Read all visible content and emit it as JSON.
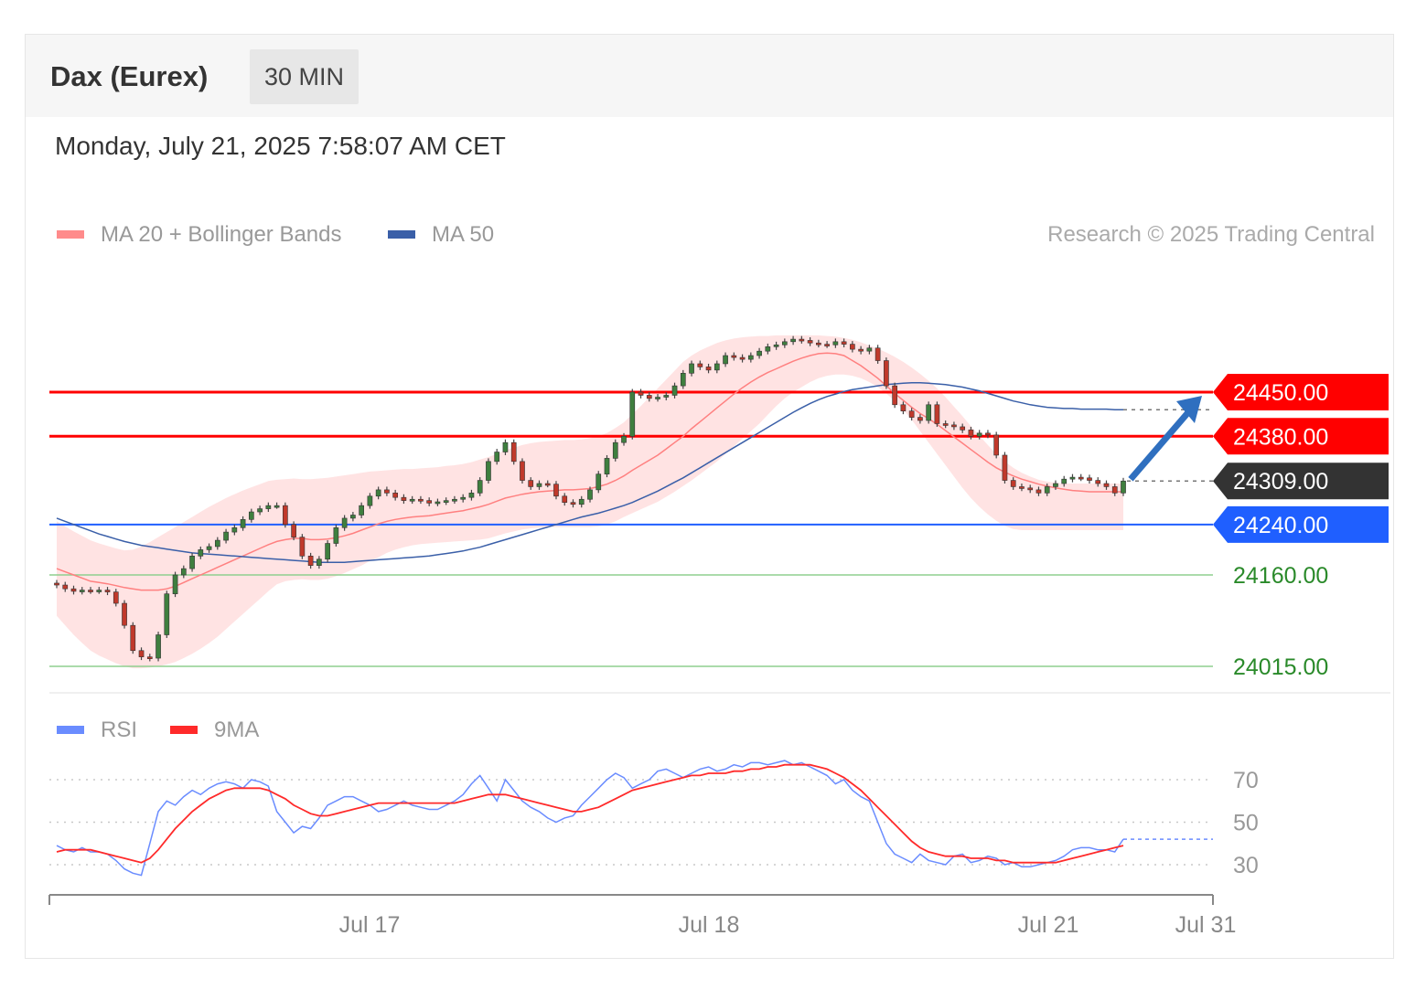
{
  "header": {
    "title": "Dax (Eurex)",
    "interval": "30 MIN",
    "datetime": "Monday, July 21, 2025 7:58:07 AM CET"
  },
  "legend": {
    "ma20": "MA 20 + Bollinger Bands",
    "ma50": "MA 50",
    "rsi": "RSI",
    "ma9": "9MA",
    "copyright": "Research © 2025 Trading Central"
  },
  "colors": {
    "resistance": "#ff0000",
    "pivot": "#1f5fff",
    "support": "#2a8a2a",
    "current": "#333333",
    "bull_candle": "#3f7f3f",
    "bear_candle": "#c0392b",
    "bollinger_fill": "#ffe0e0",
    "ma20": "#ff8080",
    "ma50": "#3a5fa8",
    "rsi": "#6a8cff",
    "ma9": "#ff2a2a",
    "arrow": "#2f6fbf"
  },
  "chart_data": [
    {
      "type": "candlestick",
      "y_range": [
        23990,
        24540
      ],
      "x_ticks": [
        "Jul 17",
        "Jul 18",
        "Jul 21",
        "Jul 31"
      ],
      "levels": [
        {
          "label": "24450.00",
          "value": 24450,
          "kind": "resistance"
        },
        {
          "label": "24380.00",
          "value": 24380,
          "kind": "resistance"
        },
        {
          "label": "24309.00",
          "value": 24309,
          "kind": "current"
        },
        {
          "label": "24240.00",
          "value": 24240,
          "kind": "pivot"
        },
        {
          "label": "24160.00",
          "value": 24160,
          "kind": "support"
        },
        {
          "label": "24015.00",
          "value": 24015,
          "kind": "support"
        }
      ],
      "close": [
        24144,
        24138,
        24134,
        24136,
        24135,
        24136,
        24133,
        24115,
        24080,
        24040,
        24030,
        24028,
        24065,
        24130,
        24160,
        24170,
        24190,
        24200,
        24205,
        24215,
        24228,
        24235,
        24248,
        24260,
        24265,
        24270,
        24270,
        24240,
        24220,
        24190,
        24175,
        24185,
        24210,
        24235,
        24250,
        24255,
        24270,
        24285,
        24295,
        24290,
        24283,
        24278,
        24280,
        24278,
        24274,
        24276,
        24278,
        24280,
        24283,
        24290,
        24310,
        24340,
        24355,
        24370,
        24340,
        24310,
        24300,
        24305,
        24304,
        24285,
        24275,
        24272,
        24280,
        24295,
        24320,
        24345,
        24370,
        24380,
        24450,
        24445,
        24440,
        24442,
        24445,
        24460,
        24480,
        24495,
        24490,
        24485,
        24495,
        24508,
        24505,
        24502,
        24508,
        24515,
        24522,
        24525,
        24530,
        24534,
        24532,
        24528,
        24526,
        24525,
        24530,
        24526,
        24518,
        24515,
        24520,
        24500,
        24460,
        24430,
        24420,
        24410,
        24405,
        24430,
        24400,
        24398,
        24395,
        24390,
        24380,
        24385,
        24382,
        24350,
        24310,
        24300,
        24298,
        24295,
        24290,
        24300,
        24305,
        24312,
        24315,
        24314,
        24310,
        24305,
        24300,
        24290,
        24309
      ],
      "ma20": [
        24170,
        24165,
        24160,
        24155,
        24150,
        24148,
        24146,
        24143,
        24140,
        24138,
        24136,
        24136,
        24136,
        24138,
        24142,
        24148,
        24154,
        24160,
        24166,
        24172,
        24178,
        24184,
        24190,
        24196,
        24202,
        24208,
        24213,
        24216,
        24218,
        24218,
        24216,
        24216,
        24217,
        24219,
        24222,
        24226,
        24231,
        24236,
        24241,
        24245,
        24248,
        24250,
        24252,
        24253,
        24254,
        24256,
        24258,
        24260,
        24262,
        24265,
        24268,
        24272,
        24277,
        24282,
        24285,
        24288,
        24290,
        24292,
        24293,
        24294,
        24295,
        24295,
        24296,
        24297,
        24300,
        24304,
        24310,
        24317,
        24326,
        24334,
        24342,
        24350,
        24360,
        24370,
        24380,
        24392,
        24403,
        24414,
        24425,
        24436,
        24447,
        24457,
        24466,
        24474,
        24481,
        24487,
        24493,
        24499,
        24504,
        24508,
        24511,
        24512,
        24511,
        24508,
        24500,
        24492,
        24482,
        24472,
        24460,
        24448,
        24437,
        24426,
        24416,
        24408,
        24399,
        24389,
        24379,
        24369,
        24359,
        24349,
        24339,
        24330,
        24323,
        24317,
        24312,
        24308,
        24304,
        24301,
        24298,
        24296,
        24294,
        24293,
        24292,
        24292,
        24292,
        24292,
        24292
      ],
      "bb_upper": [
        24245,
        24237,
        24229,
        24222,
        24215,
        24210,
        24206,
        24202,
        24199,
        24200,
        24205,
        24212,
        24220,
        24228,
        24236,
        24244,
        24252,
        24260,
        24268,
        24275,
        24282,
        24288,
        24294,
        24299,
        24304,
        24309,
        24311,
        24312,
        24313,
        24312,
        24312,
        24313,
        24314,
        24316,
        24318,
        24320,
        24322,
        24324,
        24325,
        24326,
        24327,
        24328,
        24328,
        24329,
        24330,
        24331,
        24333,
        24334,
        24336,
        24339,
        24343,
        24347,
        24352,
        24358,
        24362,
        24366,
        24369,
        24371,
        24372,
        24373,
        24374,
        24374,
        24375,
        24377,
        24380,
        24385,
        24393,
        24402,
        24415,
        24428,
        24442,
        24456,
        24470,
        24484,
        24498,
        24508,
        24516,
        24522,
        24528,
        24532,
        24535,
        24537,
        24538,
        24539,
        24539,
        24540,
        24540,
        24540,
        24540,
        24540,
        24540,
        24539,
        24538,
        24536,
        24533,
        24529,
        24524,
        24519,
        24513,
        24506,
        24498,
        24489,
        24479,
        24468,
        24456,
        24442,
        24427,
        24412,
        24396,
        24381,
        24366,
        24352,
        24340,
        24330,
        24322,
        24316,
        24311,
        24308,
        24306,
        24305,
        24305,
        24305,
        24305,
        24305,
        24305,
        24305,
        24305
      ],
      "bb_lower": [
        24095,
        24080,
        24065,
        24052,
        24040,
        24032,
        24026,
        24020,
        24015,
        24012,
        24012,
        24013,
        24015,
        24018,
        24022,
        24028,
        24035,
        24043,
        24052,
        24062,
        24074,
        24086,
        24098,
        24110,
        24122,
        24134,
        24145,
        24150,
        24152,
        24153,
        24152,
        24152,
        24154,
        24158,
        24163,
        24169,
        24175,
        24182,
        24188,
        24195,
        24200,
        24204,
        24207,
        24209,
        24210,
        24211,
        24212,
        24213,
        24214,
        24215,
        24216,
        24218,
        24222,
        24226,
        24229,
        24232,
        24234,
        24235,
        24236,
        24236,
        24236,
        24236,
        24236,
        24236,
        24237,
        24240,
        24245,
        24252,
        24258,
        24264,
        24270,
        24276,
        24284,
        24292,
        24301,
        24310,
        24320,
        24330,
        24340,
        24352,
        24364,
        24376,
        24388,
        24400,
        24414,
        24428,
        24440,
        24450,
        24458,
        24466,
        24472,
        24476,
        24478,
        24478,
        24476,
        24472,
        24466,
        24458,
        24448,
        24436,
        24422,
        24406,
        24388,
        24370,
        24352,
        24334,
        24316,
        24298,
        24282,
        24268,
        24256,
        24246,
        24238,
        24233,
        24231,
        24231,
        24231,
        24231,
        24231,
        24231,
        24231,
        24231,
        24231,
        24231,
        24231,
        24231,
        24231
      ],
      "ma50": [
        24250,
        24245,
        24240,
        24235,
        24230,
        24225,
        24221,
        24217,
        24213,
        24210,
        24207,
        24205,
        24203,
        24201,
        24199,
        24197,
        24195,
        24194,
        24193,
        24192,
        24191,
        24190,
        24189,
        24188,
        24187,
        24186,
        24185,
        24184,
        24183,
        24182,
        24181,
        24180,
        24180,
        24180,
        24180,
        24181,
        24182,
        24183,
        24184,
        24185,
        24186,
        24187,
        24188,
        24189,
        24190,
        24192,
        24194,
        24196,
        24198,
        24201,
        24204,
        24208,
        24212,
        24216,
        24220,
        24224,
        24228,
        24232,
        24236,
        24240,
        24244,
        24248,
        24252,
        24255,
        24258,
        24262,
        24266,
        24270,
        24275,
        24281,
        24287,
        24293,
        24300,
        24307,
        24314,
        24322,
        24330,
        24338,
        24346,
        24354,
        24362,
        24370,
        24378,
        24386,
        24394,
        24402,
        24410,
        24418,
        24425,
        24432,
        24438,
        24443,
        24447,
        24451,
        24454,
        24456,
        24458,
        24460,
        24462,
        24463,
        24464,
        24465,
        24465,
        24464,
        24463,
        24462,
        24460,
        24458,
        24455,
        24452,
        24448,
        24444,
        24440,
        24436,
        24433,
        24430,
        24428,
        24426,
        24425,
        24424,
        24424,
        24423,
        24423,
        24423,
        24423,
        24422,
        24422
      ]
    },
    {
      "type": "line",
      "y_ticks": [
        30,
        50,
        70
      ],
      "series": [
        {
          "name": "RSI",
          "values": [
            39,
            37,
            36,
            38,
            36,
            36,
            35,
            32,
            28,
            26,
            25,
            40,
            55,
            60,
            58,
            62,
            65,
            63,
            66,
            68,
            69,
            68,
            66,
            70,
            69,
            67,
            55,
            50,
            45,
            48,
            47,
            52,
            58,
            60,
            62,
            62,
            60,
            58,
            55,
            56,
            58,
            60,
            58,
            57,
            56,
            56,
            58,
            60,
            63,
            68,
            72,
            66,
            60,
            70,
            65,
            60,
            57,
            55,
            52,
            50,
            52,
            53,
            58,
            62,
            66,
            70,
            73,
            71,
            66,
            68,
            70,
            74,
            75,
            73,
            71,
            73,
            75,
            76,
            74,
            75,
            77,
            76,
            78,
            78,
            77,
            78,
            79,
            77,
            78,
            76,
            74,
            72,
            68,
            70,
            65,
            62,
            60,
            50,
            40,
            35,
            33,
            31,
            35,
            32,
            31,
            30,
            34,
            35,
            31,
            32,
            34,
            33,
            30,
            31,
            29,
            29,
            30,
            31,
            32,
            34,
            37,
            38,
            38,
            37,
            37,
            36,
            42
          ]
        },
        {
          "name": "9MA",
          "values": [
            36,
            37,
            37,
            37,
            37,
            36,
            35,
            34,
            33,
            32,
            31,
            33,
            37,
            42,
            47,
            51,
            55,
            58,
            61,
            63,
            65,
            66,
            66,
            66,
            66,
            65,
            63,
            61,
            58,
            56,
            54,
            53,
            53,
            54,
            55,
            56,
            57,
            58,
            59,
            59,
            59,
            59,
            59,
            59,
            59,
            59,
            59,
            59,
            60,
            61,
            62,
            63,
            63,
            63,
            62,
            61,
            60,
            59,
            58,
            57,
            56,
            55,
            55,
            56,
            57,
            59,
            61,
            63,
            65,
            66,
            67,
            68,
            69,
            70,
            71,
            72,
            72,
            73,
            73,
            73,
            74,
            74,
            75,
            75,
            76,
            76,
            77,
            77,
            77,
            77,
            76,
            75,
            73,
            71,
            68,
            65,
            61,
            57,
            53,
            49,
            45,
            41,
            38,
            36,
            35,
            34,
            34,
            34,
            33,
            33,
            33,
            32,
            32,
            31,
            31,
            31,
            31,
            31,
            31,
            32,
            33,
            34,
            35,
            36,
            37,
            38,
            39
          ]
        }
      ]
    }
  ]
}
